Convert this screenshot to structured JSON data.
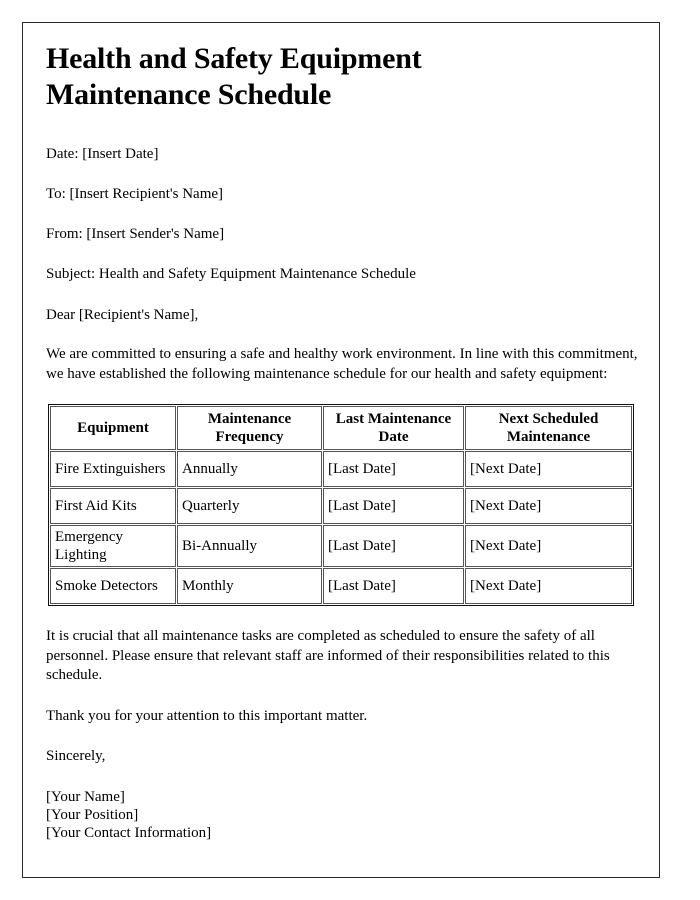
{
  "document": {
    "title": "Health and Safety Equipment Maintenance Schedule",
    "meta": {
      "date_line": "Date: [Insert Date]",
      "to_line": "To: [Insert Recipient's Name]",
      "from_line": "From: [Insert Sender's Name]",
      "subject_line": "Subject: Health and Safety Equipment Maintenance Schedule",
      "salutation": "Dear [Recipient's Name],"
    },
    "intro_paragraph": "We are committed to ensuring a safe and healthy work environment. In line with this commitment, we have established the following maintenance schedule for our health and safety equipment:",
    "table": {
      "headers": [
        "Equipment",
        "Maintenance Frequency",
        "Last Maintenance Date",
        "Next Scheduled Maintenance"
      ],
      "rows": [
        {
          "equipment": "Fire Extinguishers",
          "frequency": "Annually",
          "last_maintenance": "[Last Date]",
          "next_maintenance": "[Next Date]"
        },
        {
          "equipment": "First Aid Kits",
          "frequency": "Quarterly",
          "last_maintenance": "[Last Date]",
          "next_maintenance": "[Next Date]"
        },
        {
          "equipment": "Emergency Lighting",
          "frequency": "Bi-Annually",
          "last_maintenance": "[Last Date]",
          "next_maintenance": "[Next Date]"
        },
        {
          "equipment": "Smoke Detectors",
          "frequency": "Monthly",
          "last_maintenance": "[Last Date]",
          "next_maintenance": "[Next Date]"
        }
      ]
    },
    "closing_paragraph": "It is crucial that all maintenance tasks are completed as scheduled to ensure the safety of all personnel. Please ensure that relevant staff are informed of their responsibilities related to this schedule.",
    "thanks_paragraph": "Thank you for your attention to this important matter.",
    "signoff": "Sincerely,",
    "signature": {
      "name": "[Your Name]",
      "position": "[Your Position]",
      "contact": "[Your Contact Information]"
    }
  },
  "colors": {
    "page_border": "#2b2b2b",
    "text": "#000000",
    "table_border": "#555555",
    "table_outer_border": "#111111",
    "background": "#ffffff"
  }
}
